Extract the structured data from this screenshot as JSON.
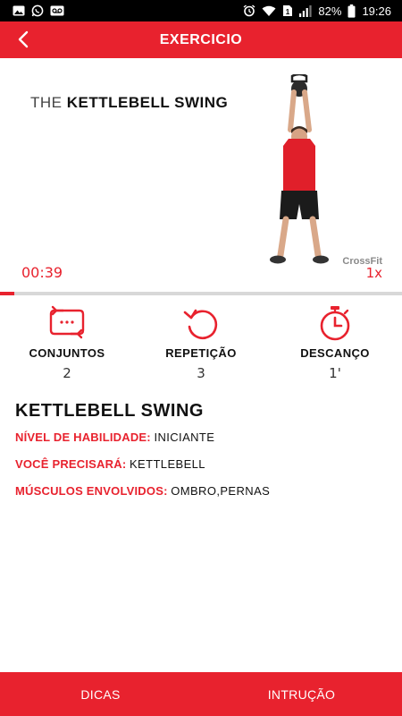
{
  "status_bar": {
    "battery": "82%",
    "time": "19:26",
    "icons": [
      "image-icon",
      "whatsapp-icon",
      "voicemail-icon",
      "alarm-icon",
      "wifi-icon",
      "sim-icon",
      "signal-icon",
      "battery-icon"
    ]
  },
  "header": {
    "title": "EXERCICIO",
    "back_icon": "chevron-left-icon"
  },
  "video": {
    "title_thin": "THE",
    "title_bold": "KETTLEBELL SWING",
    "brand": "CrossFit",
    "time": "00:39",
    "speed": "1x",
    "progress": 0.035
  },
  "stats": [
    {
      "label": "CONJUNTOS",
      "value": "2",
      "icon": "repeat-icon"
    },
    {
      "label": "REPETIÇÃO",
      "value": "3",
      "icon": "replay-icon"
    },
    {
      "label": "DESCANÇO",
      "value": "1'",
      "icon": "stopwatch-icon"
    }
  ],
  "details": {
    "name": "KETTLEBELL SWING",
    "rows": [
      {
        "key": "NÍVEL DE HABILIDADE:",
        "value": "INICIANTE"
      },
      {
        "key": "VOCÊ PRECISARÁ:",
        "value": "KETTLEBELL"
      },
      {
        "key": "MÚSCULOS ENVOLVIDOS:",
        "value": "OMBRO,PERNAS"
      }
    ]
  },
  "bottom_tabs": [
    {
      "label": "DICAS"
    },
    {
      "label": "INTRUÇÃO"
    }
  ],
  "colors": {
    "accent": "#e8222e",
    "status_bar": "#000000",
    "progress_track": "#d8d8d8"
  }
}
